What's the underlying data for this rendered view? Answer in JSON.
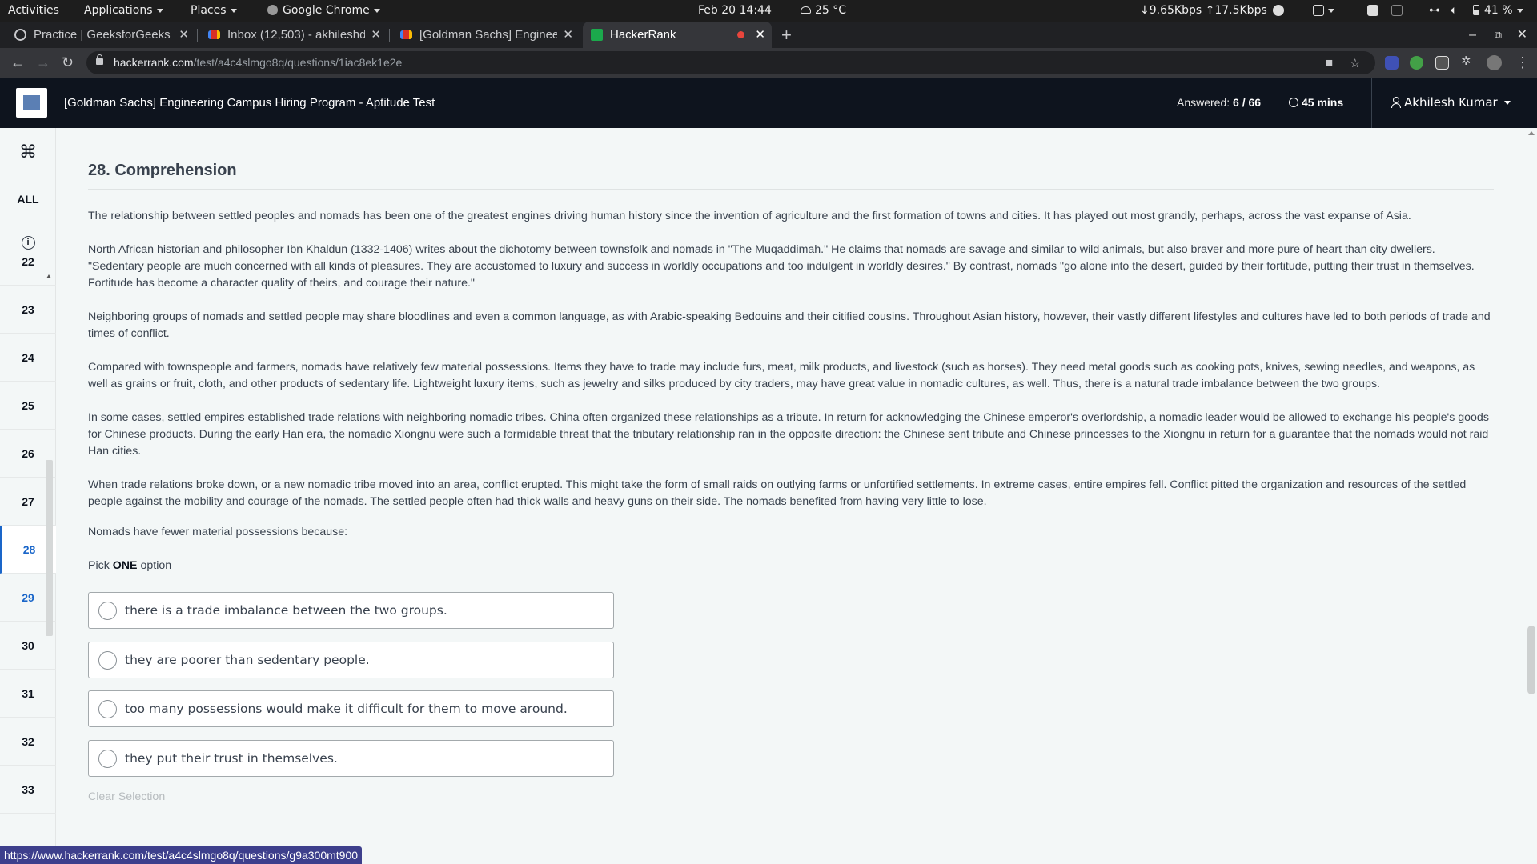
{
  "system_bar": {
    "activities": "Activities",
    "applications": "Applications",
    "places": "Places",
    "app_name": "Google Chrome",
    "datetime": "Feb 20  14:44",
    "weather": "25 °C",
    "network": "↓9.65Kbps ↑17.5Kbps",
    "battery": "41 %"
  },
  "tabs": [
    {
      "title": "Practice | GeeksforGeeks |",
      "favicon_color": "#c8c9cc"
    },
    {
      "title": "Inbox (12,503) - akhileshd",
      "favicon_color": "#d93025"
    },
    {
      "title": "[Goldman Sachs] Enginee",
      "favicon_color": "#d93025"
    },
    {
      "title": "HackerRank",
      "favicon_color": "#1ba94c",
      "active": true
    }
  ],
  "address": {
    "host": "hackerrank.com",
    "path": "/test/a4c4slmgo8q/questions/1iac8ek1e2e"
  },
  "header": {
    "test_title": "[Goldman Sachs] Engineering Campus Hiring Program - Aptitude Test",
    "answered_label": "Answered:",
    "answered_value": "6 / 66",
    "time_left": "45 mins",
    "user_name": "Akhilesh Kumar"
  },
  "sidebar": {
    "all_label": "ALL",
    "questions": [
      "22",
      "23",
      "24",
      "25",
      "26",
      "27",
      "28",
      "29",
      "30",
      "31",
      "32",
      "33"
    ],
    "current": "28"
  },
  "question": {
    "title": "28. Comprehension",
    "paragraphs": [
      "The relationship between settled peoples and nomads has been one of the greatest engines driving human history since the invention of agriculture and the first formation of towns and cities. It has played out most grandly, perhaps, across the vast expanse of Asia.",
      "North African historian and philosopher Ibn Khaldun (1332-1406) writes about the dichotomy between townsfolk and nomads in \"The Muqaddimah.\" He claims that nomads are savage and similar to wild animals, but also braver and more pure of heart than city dwellers. \"Sedentary people are much concerned with all kinds of pleasures. They are accustomed to luxury and success in worldly occupations and too indulgent in worldly desires.\" By contrast, nomads \"go alone into the desert, guided by their fortitude, putting their trust in themselves. Fortitude has become a character quality of theirs, and courage their nature.\"",
      "Neighboring groups of nomads and settled people may share bloodlines and even a common language, as with Arabic-speaking Bedouins and their citified cousins. Throughout Asian history, however, their vastly different lifestyles and cultures have led to both periods of trade and times of conflict.",
      "Compared with townspeople and farmers, nomads have relatively few material possessions. Items they have to trade may include furs, meat, milk products, and livestock (such as horses). They need metal goods such as cooking pots, knives, sewing needles, and weapons, as well as grains or fruit, cloth, and other products of sedentary life. Lightweight luxury items, such as jewelry and silks produced by city traders, may have great value in nomadic cultures, as well. Thus, there is a natural trade imbalance between the two groups.",
      "In some cases, settled empires established trade relations with neighboring nomadic tribes. China often organized these relationships as a tribute. In return for acknowledging the Chinese emperor's overlordship, a nomadic leader would be allowed to exchange his people's goods for Chinese products. During the early Han era, the nomadic Xiongnu were such a formidable threat that the tributary relationship ran in the opposite direction: the Chinese sent tribute and Chinese princesses to the Xiongnu in return for a guarantee that the nomads would not raid Han cities.",
      "When trade relations broke down, or a new nomadic tribe moved into an area, conflict erupted. This might take the form of small raids on outlying farms or unfortified settlements. In extreme cases, entire empires fell. Conflict pitted the organization and resources of the settled people against the mobility and courage of the nomads. The settled people often had thick walls and heavy guns on their side. The nomads benefited from having very little to lose."
    ],
    "prompt": "Nomads have fewer material possessions because:",
    "pick_prefix": "Pick",
    "pick_bold": "ONE",
    "pick_suffix": "option",
    "options": [
      "there is a trade imbalance between the two groups.",
      "they are poorer than sedentary people.",
      "too many possessions would make it difficult for them to move around.",
      "they put their trust in themselves."
    ],
    "clear_label": "Clear Selection"
  },
  "status_link": "https://www.hackerrank.com/test/a4c4slmgo8q/questions/g9a300mt900"
}
